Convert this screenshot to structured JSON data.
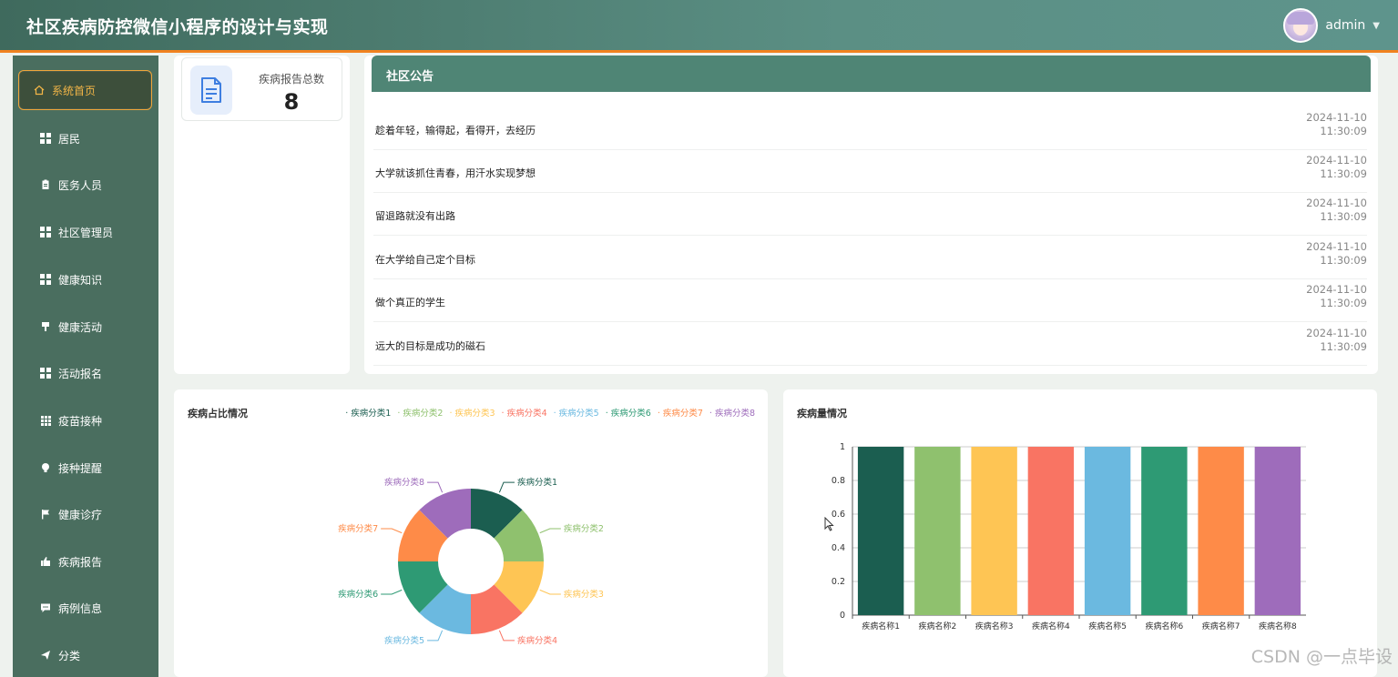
{
  "header": {
    "title": "社区疾病防控微信小程序的设计与实现",
    "user": "admin"
  },
  "sidebar": {
    "items": [
      {
        "label": "系统首页",
        "icon": "home-icon"
      },
      {
        "label": "居民",
        "icon": "grid-icon"
      },
      {
        "label": "医务人员",
        "icon": "clipboard-icon"
      },
      {
        "label": "社区管理员",
        "icon": "grid-icon"
      },
      {
        "label": "健康知识",
        "icon": "grid-icon"
      },
      {
        "label": "健康活动",
        "icon": "brush-icon"
      },
      {
        "label": "活动报名",
        "icon": "grid-icon"
      },
      {
        "label": "疫苗接种",
        "icon": "grid9-icon"
      },
      {
        "label": "接种提醒",
        "icon": "bulb-icon"
      },
      {
        "label": "健康诊疗",
        "icon": "flag-icon"
      },
      {
        "label": "疾病报告",
        "icon": "thumb-icon"
      },
      {
        "label": "病例信息",
        "icon": "chat-icon"
      },
      {
        "label": "分类",
        "icon": "send-icon"
      }
    ]
  },
  "stat": {
    "label": "疾病报告总数",
    "value": "8"
  },
  "notice": {
    "title": "社区公告",
    "items": [
      {
        "text": "趁着年轻，输得起，看得开，去经历",
        "date": "2024-11-10",
        "time": "11:30:09"
      },
      {
        "text": "大学就该抓住青春，用汗水实现梦想",
        "date": "2024-11-10",
        "time": "11:30:09"
      },
      {
        "text": "留退路就没有出路",
        "date": "2024-11-10",
        "time": "11:30:09"
      },
      {
        "text": "在大学给自己定个目标",
        "date": "2024-11-10",
        "time": "11:30:09"
      },
      {
        "text": "做个真正的学生",
        "date": "2024-11-10",
        "time": "11:30:09"
      },
      {
        "text": "远大的目标是成功的磁石",
        "date": "2024-11-10",
        "time": "11:30:09"
      }
    ]
  },
  "chart_data": [
    {
      "type": "pie",
      "title": "疾病占比情况",
      "categories": [
        "疾病分类1",
        "疾病分类2",
        "疾病分类3",
        "疾病分类4",
        "疾病分类5",
        "疾病分类6",
        "疾病分类7",
        "疾病分类8"
      ],
      "values": [
        1,
        1,
        1,
        1,
        1,
        1,
        1,
        1
      ],
      "colors": [
        "#1b5e50",
        "#8fc16e",
        "#fec554",
        "#f97463",
        "#6bb9e0",
        "#2e9a74",
        "#fe8b48",
        "#9e6cbb"
      ],
      "legend": "top-right"
    },
    {
      "type": "bar",
      "title": "疾病量情况",
      "categories": [
        "疾病名称1",
        "疾病名称2",
        "疾病名称3",
        "疾病名称4",
        "疾病名称5",
        "疾病名称6",
        "疾病名称7",
        "疾病名称8"
      ],
      "values": [
        1,
        1,
        1,
        1,
        1,
        1,
        1,
        1
      ],
      "colors": [
        "#1b5e50",
        "#8fc16e",
        "#fec554",
        "#f97463",
        "#6bb9e0",
        "#2e9a74",
        "#fe8b48",
        "#9e6cbb"
      ],
      "ylim": [
        0,
        1
      ],
      "yticks": [
        "0",
        "0.2",
        "0.4",
        "0.6",
        "0.8",
        "1"
      ],
      "grid": true
    }
  ],
  "watermark": "CSDN @一点毕设"
}
